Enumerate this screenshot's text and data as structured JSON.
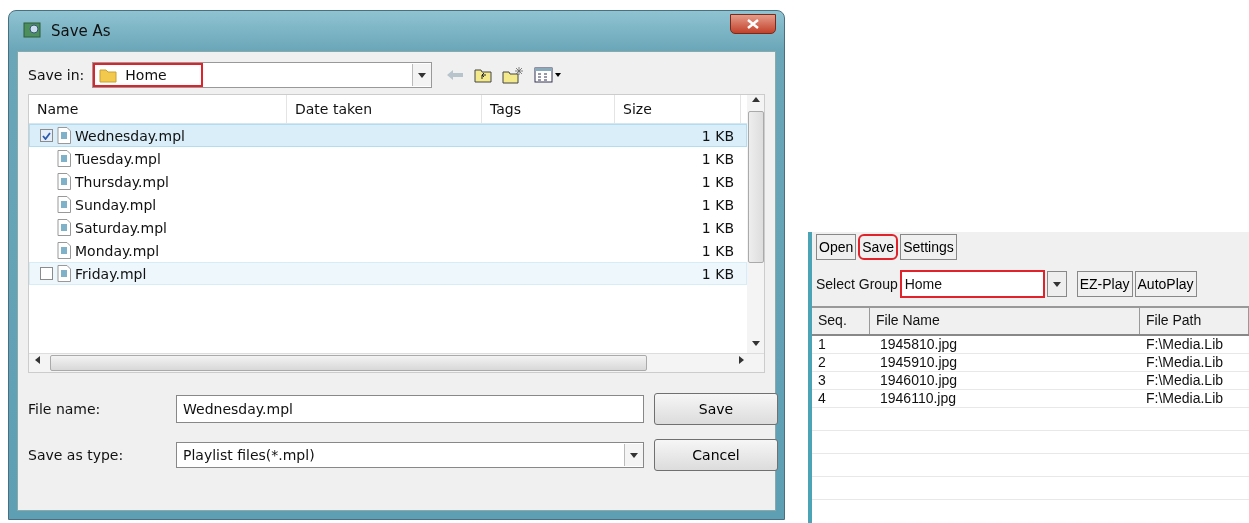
{
  "dialog": {
    "title": "Save As",
    "save_in": {
      "label": "Save in:",
      "value": "Home",
      "highlighted": true
    },
    "columns": [
      "Name",
      "Date taken",
      "Tags",
      "Size"
    ],
    "files": [
      {
        "name": "Wednesday.mpl",
        "size": "1 KB",
        "selected": true,
        "hovered": false,
        "checked": true
      },
      {
        "name": "Tuesday.mpl",
        "size": "1 KB",
        "selected": false,
        "hovered": false
      },
      {
        "name": "Thursday.mpl",
        "size": "1 KB",
        "selected": false,
        "hovered": false
      },
      {
        "name": "Sunday.mpl",
        "size": "1 KB",
        "selected": false,
        "hovered": false
      },
      {
        "name": "Saturday.mpl",
        "size": "1 KB",
        "selected": false,
        "hovered": false
      },
      {
        "name": "Monday.mpl",
        "size": "1 KB",
        "selected": false,
        "hovered": false
      },
      {
        "name": "Friday.mpl",
        "size": "1 KB",
        "selected": false,
        "hovered": true,
        "checked": false
      }
    ],
    "file_name": {
      "label": "File name:",
      "value": "Wednesday.mpl"
    },
    "save_as_type": {
      "label": "Save as type:",
      "value": "Playlist files(*.mpl)"
    },
    "buttons": [
      "Save",
      "Cancel"
    ]
  },
  "player": {
    "toolbar": [
      {
        "label": "Open",
        "highlighted": false
      },
      {
        "label": "Save",
        "highlighted": true
      },
      {
        "label": "Settings",
        "highlighted": false
      }
    ],
    "group": {
      "label": "Select Group",
      "value": "Home",
      "highlighted": true
    },
    "group_buttons": [
      "EZ-Play",
      "AutoPlay"
    ],
    "columns": [
      "Seq.",
      "File Name",
      "File Path"
    ],
    "rows": [
      [
        "1",
        "1945810.jpg",
        "F:\\Media.Lib"
      ],
      [
        "2",
        "1945910.jpg",
        "F:\\Media.Lib"
      ],
      [
        "3",
        "1946010.jpg",
        "F:\\Media.Lib"
      ],
      [
        "4",
        "1946110.jpg",
        "F:\\Media.Lib"
      ]
    ]
  }
}
